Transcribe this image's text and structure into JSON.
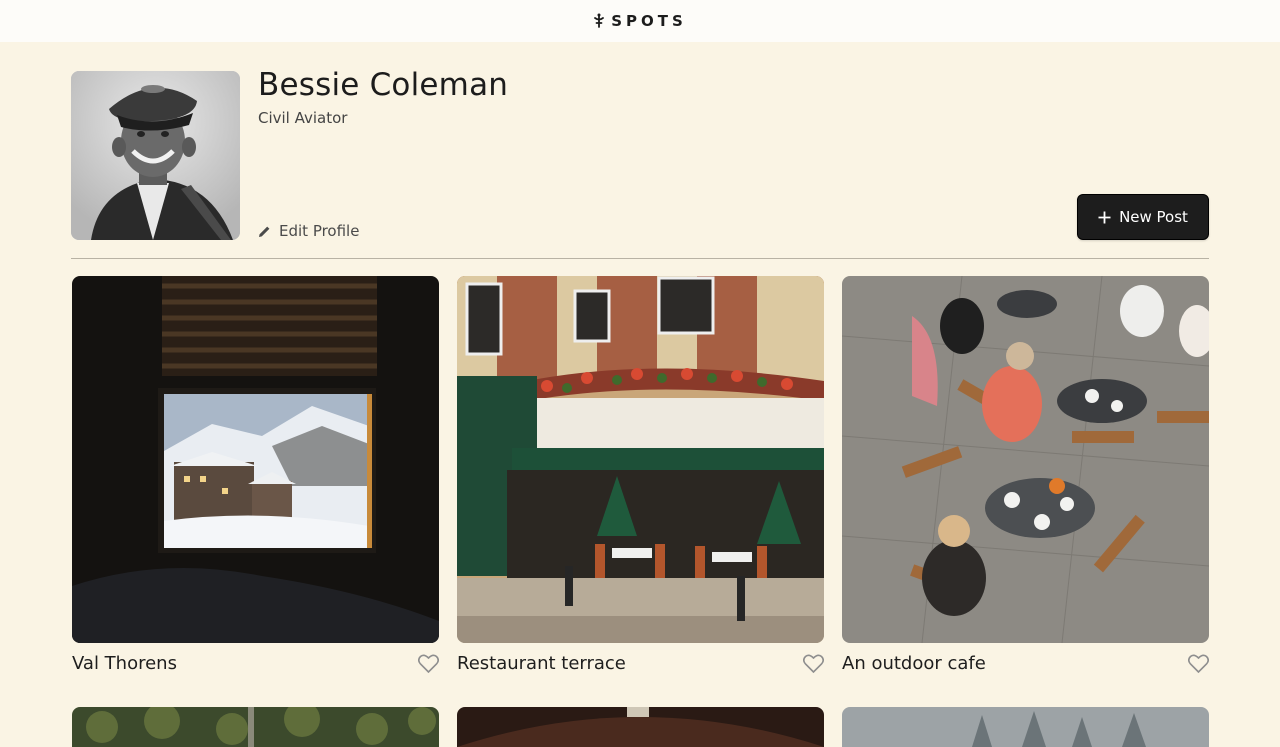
{
  "header": {
    "logo_text": "SPOTS"
  },
  "profile": {
    "name": "Bessie Coleman",
    "description": "Civil Aviator",
    "edit_label": "Edit Profile",
    "new_post_label": "New Post"
  },
  "cards": [
    {
      "title": "Val Thorens",
      "liked": false
    },
    {
      "title": "Restaurant terrace",
      "liked": false
    },
    {
      "title": "An outdoor cafe",
      "liked": false
    }
  ],
  "colors": {
    "page_background": "#faf4e4",
    "header_background": "#fdfcf9",
    "button_dark": "#1d1d1d",
    "text_primary": "#1c1c1c"
  }
}
